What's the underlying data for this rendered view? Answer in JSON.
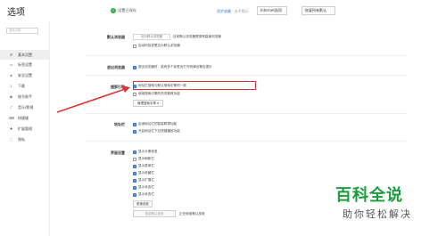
{
  "app": {
    "title": "选项"
  },
  "topbar": {
    "saved_text": "设置已保存",
    "sync_link": "同步收藏",
    "sync_gray": " · 永不提示",
    "internet_btn": "Internet选项",
    "restore_btn": "恢复所有默认"
  },
  "sidebar": {
    "search_placeholder": "搜索设置",
    "items": [
      {
        "label": "基本设置",
        "icon": "gear-icon",
        "glyph": "⚙"
      },
      {
        "label": "标签设置",
        "icon": "tab-icon",
        "glyph": "▭"
      },
      {
        "label": "安全设置",
        "icon": "shield-icon",
        "glyph": "◈"
      },
      {
        "label": "下载",
        "icon": "download-icon",
        "glyph": "↓"
      },
      {
        "label": "账号助手",
        "icon": "account-icon",
        "glyph": "◉"
      },
      {
        "label": "音乐/影视",
        "icon": "music-icon",
        "glyph": "♪"
      },
      {
        "label": "快捷键",
        "icon": "keyboard-icon",
        "glyph": "⌨"
      },
      {
        "label": "扩展管理",
        "icon": "extension-icon",
        "glyph": "✚"
      },
      {
        "label": "隐私",
        "icon": "privacy-icon",
        "glyph": "◌"
      }
    ]
  },
  "main": {
    "default_browser": {
      "label": "默认浏览器",
      "button": "设为默认浏览器",
      "status": "目前默认浏览器是搜狗高速浏览器",
      "check_label": "启动时检查是否为默认浏览器",
      "check_on": false
    },
    "close_browser": {
      "label": "退出浏览器",
      "check_label": "退出浏览器时，若有多个标签页打开则弹出警告提示",
      "check_on": true
    },
    "search_engine": {
      "label": "搜索引擎",
      "check1_label": "地址栏搜索与默认搜索引擎同一致",
      "check1_on": true,
      "check2_label": "使用搜索引擎的热词推荐功能",
      "check2_on": false,
      "manage_btn": "管理搜索引擎"
    },
    "address_bar": {
      "label": "地址栏",
      "check1_label": "启用地址栏的智能联想功能",
      "check1_on": true,
      "check2_label": "开启地址栏下拉快捷播放功能",
      "check2_on": true
    },
    "interface": {
      "label": "界面设置",
      "items": [
        {
          "label": "显示头像信息",
          "on": true
        },
        {
          "label": "显示刷新栏",
          "on": false
        },
        {
          "label": "显示菜单栏",
          "on": true
        },
        {
          "label": "显示收藏栏",
          "on": true
        },
        {
          "label": "显示扩展栏",
          "on": true
        },
        {
          "label": "显示状态栏",
          "on": true
        },
        {
          "label": "显示状态栏",
          "on": true
        }
      ],
      "skin_btn": "更换皮肤",
      "restore_btn": "恢复默认皮肤",
      "using_text": "正在使用默认皮肤"
    }
  },
  "watermark": {
    "logo": "百科全说",
    "sub": "助你轻松解决"
  },
  "colors": {
    "accent": "#3a7bd5",
    "highlight": "#e03434",
    "watermark": "#1a9e3d"
  }
}
